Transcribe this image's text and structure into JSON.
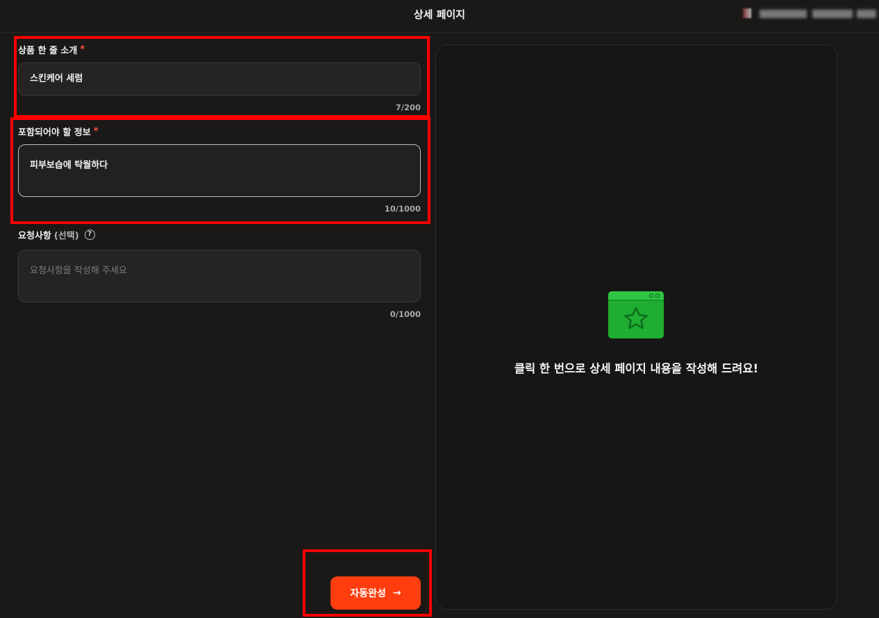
{
  "header": {
    "title": "상세 페이지"
  },
  "form": {
    "intro": {
      "label": "상품 한 줄 소개",
      "required_mark": "*",
      "value": "스킨케어 세럼",
      "counter": "7/200"
    },
    "info": {
      "label": "포함되어야 할 정보",
      "required_mark": "*",
      "value": "피부보습에 탁월하다",
      "counter": "10/1000"
    },
    "request": {
      "label": "요청사항",
      "optional_label": "(선택)",
      "help_icon": "?",
      "placeholder": "요청사항을 작성해 주세요",
      "counter": "0/1000"
    },
    "submit": {
      "label": "자동완성",
      "arrow": "→"
    }
  },
  "preview": {
    "icon": "window-star-icon",
    "message": "클릭 한 번으로 상세 페이지 내용을 작성해 드려요!"
  },
  "colors": {
    "accent": "#ff3d0f",
    "required": "#ff4d2e",
    "highlight": "#ff0000",
    "icon_green": "#22b535"
  }
}
